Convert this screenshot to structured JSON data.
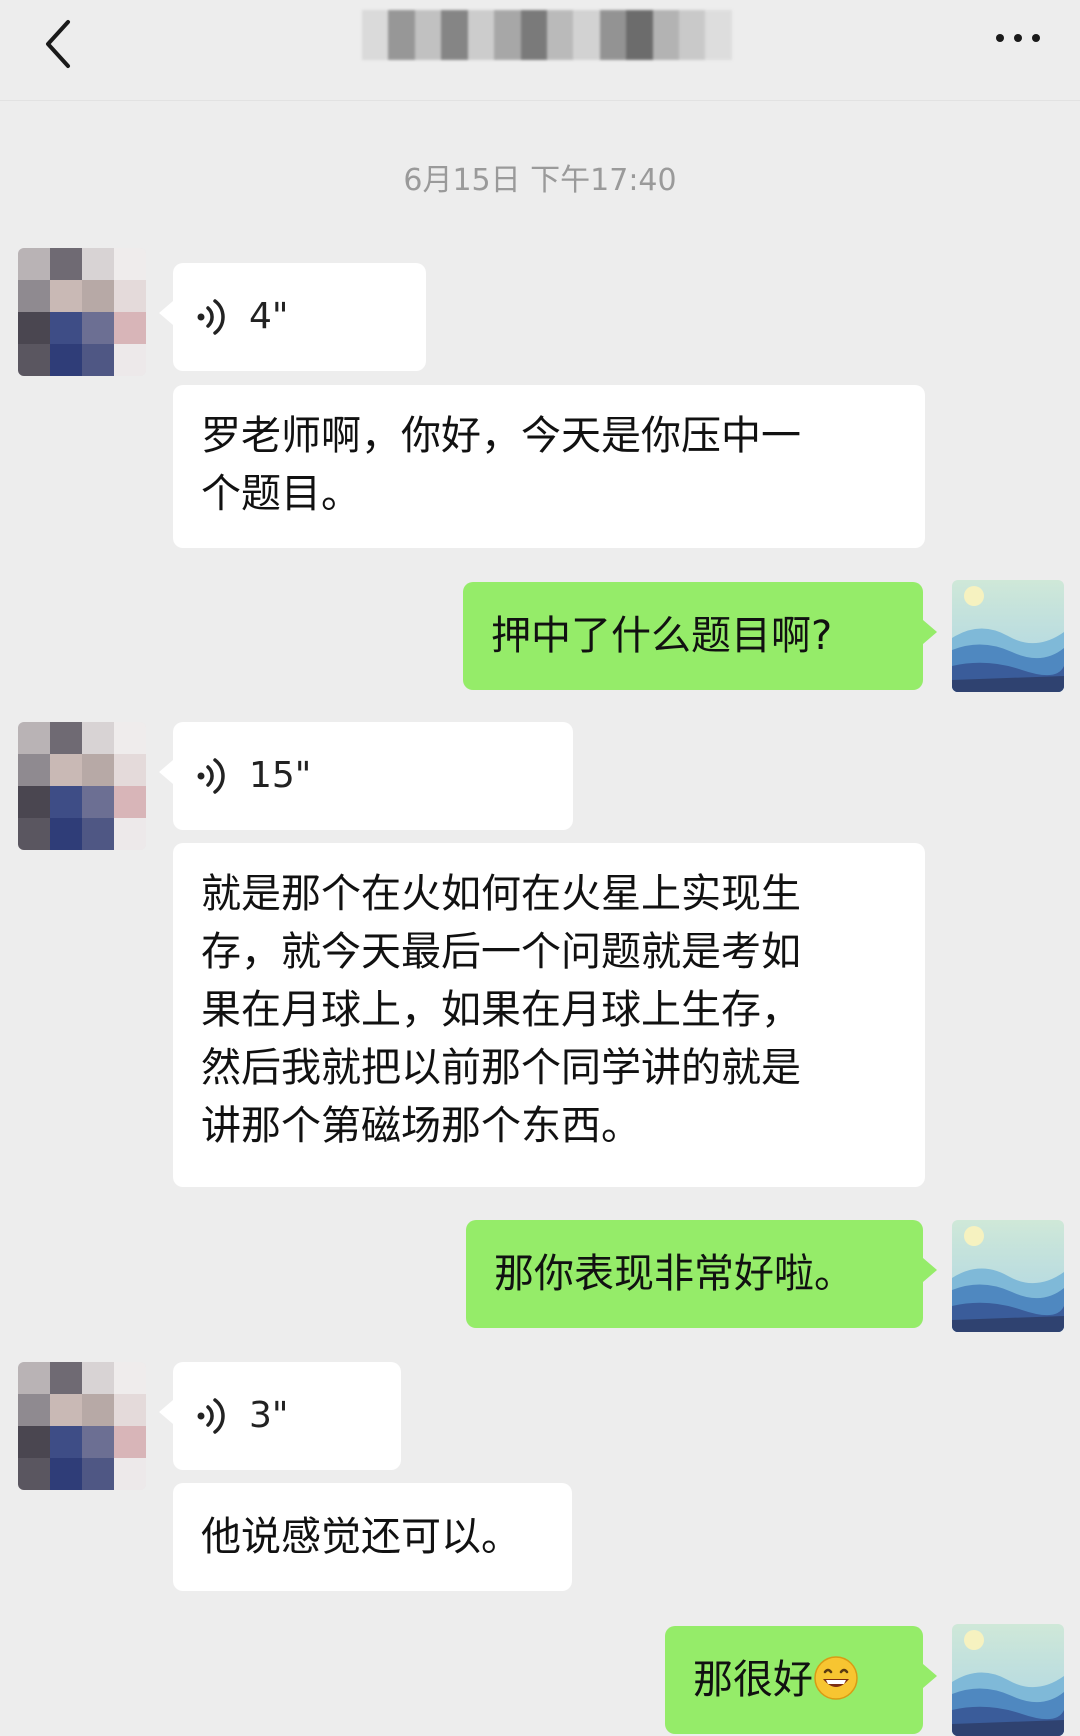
{
  "header": {
    "back_icon": "chevron-left-icon",
    "title_blurred": true,
    "more_icon": "ellipsis-icon"
  },
  "timestamp": "6月15日 下午17:40",
  "messages": [
    {
      "sender": "contact",
      "type": "voice",
      "duration": "4\""
    },
    {
      "sender": "contact",
      "type": "text",
      "lines": [
        "罗老师啊，你好，今天是你压中一",
        "个题目。"
      ]
    },
    {
      "sender": "me",
      "type": "text",
      "lines": [
        "押中了什么题目啊?"
      ]
    },
    {
      "sender": "contact",
      "type": "voice",
      "duration": "15\""
    },
    {
      "sender": "contact",
      "type": "text",
      "lines": [
        "就是那个在火如何在火星上实现生",
        "存，就今天最后一个问题就是考如",
        "果在月球上，如果在月球上生存，",
        "然后我就把以前那个同学讲的就是",
        "讲那个第磁场那个东西。"
      ]
    },
    {
      "sender": "me",
      "type": "text",
      "lines": [
        "那你表现非常好啦。"
      ]
    },
    {
      "sender": "contact",
      "type": "voice",
      "duration": "3\""
    },
    {
      "sender": "contact",
      "type": "text",
      "lines": [
        "他说感觉还可以。"
      ]
    },
    {
      "sender": "me",
      "type": "text",
      "lines": [
        "那很好"
      ],
      "emoji": "grinning-face-icon"
    }
  ],
  "colors": {
    "background": "#ededed",
    "incoming_bubble": "#ffffff",
    "outgoing_bubble": "#95ec69",
    "timestamp": "#9a9a9a"
  }
}
